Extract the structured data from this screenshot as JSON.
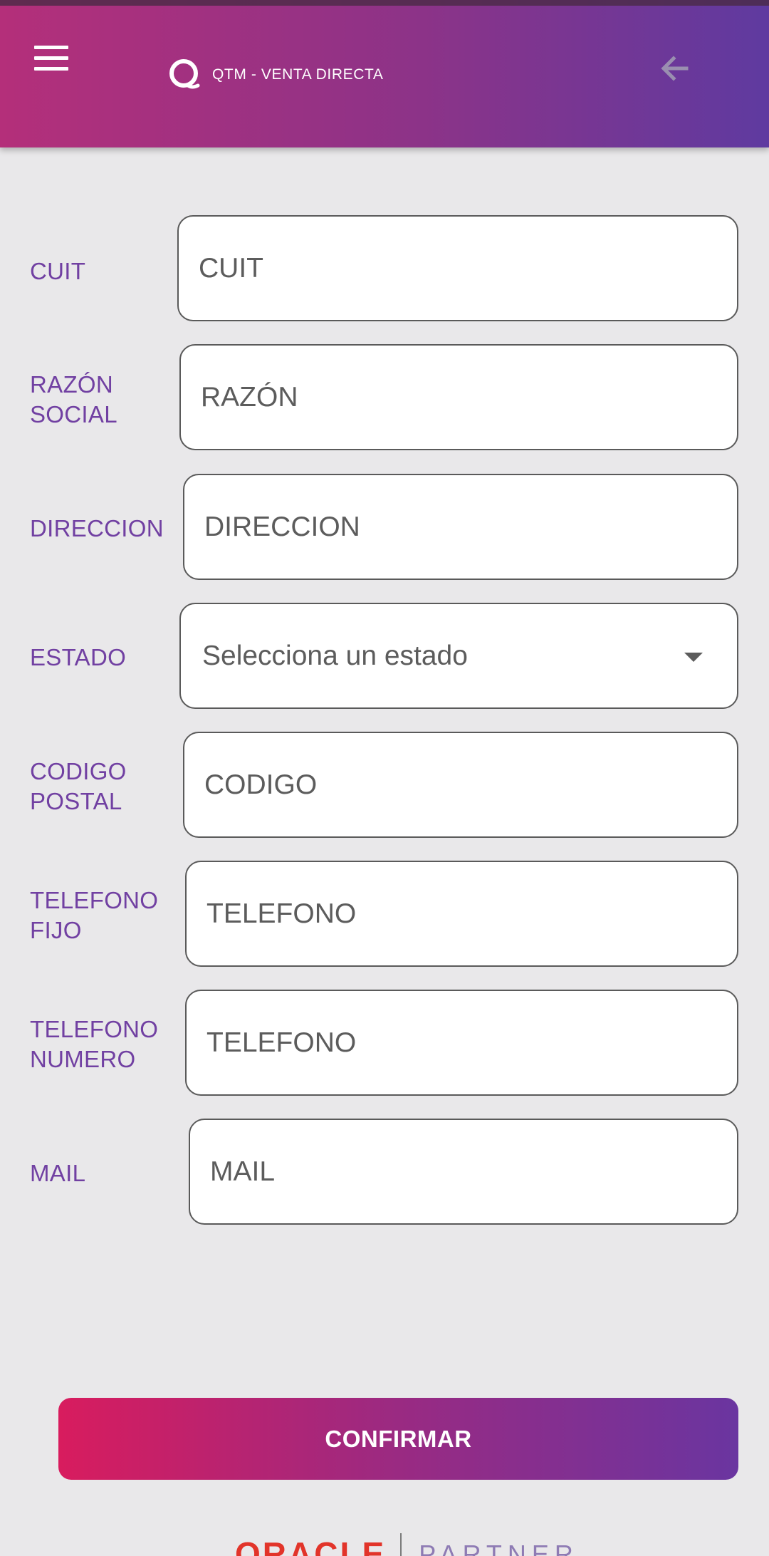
{
  "header": {
    "title": "QTM - VENTA DIRECTA",
    "menu_icon": "hamburger-menu-icon",
    "back_icon": "arrow-left-icon",
    "logo_icon": "q-logo-icon"
  },
  "form": {
    "cuit": {
      "label": "CUIT",
      "placeholder": "CUIT"
    },
    "razon": {
      "label": "RAZÓN\nSOCIAL",
      "placeholder": "RAZÓN"
    },
    "direccion": {
      "label": "DIRECCION",
      "placeholder": "DIRECCION"
    },
    "estado": {
      "label": "ESTADO",
      "value": "Selecciona un estado"
    },
    "codigo": {
      "label": "CODIGO\n POSTAL",
      "placeholder": "CODIGO"
    },
    "telefono_fijo": {
      "label": "TELEFONO\n FIJO",
      "placeholder": "TELEFONO"
    },
    "telefono_numero": {
      "label": "TELEFONO\n NUMERO",
      "placeholder": "TELEFONO"
    },
    "mail": {
      "label": "MAIL",
      "placeholder": "MAIL"
    }
  },
  "actions": {
    "confirm_label": "CONFIRMAR"
  },
  "footer": {
    "brand": "ORACLE",
    "partner": "PARTNER"
  },
  "colors": {
    "label": "#7140a2",
    "header_start": "#b42f7a",
    "header_end": "#5f3aa0",
    "button_start": "#d81c5e",
    "button_end": "#6a35a0",
    "oracle_red": "#e2342a"
  }
}
